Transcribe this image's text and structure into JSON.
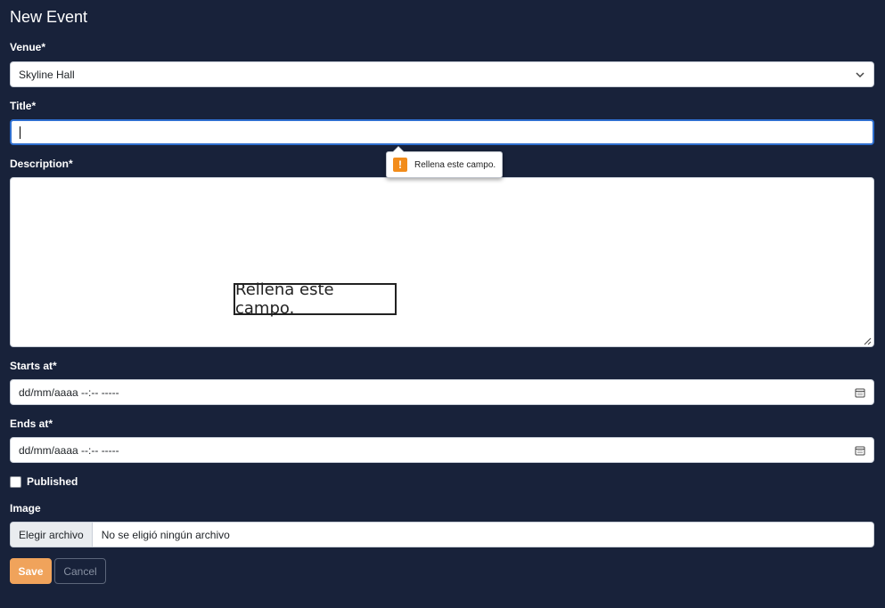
{
  "page": {
    "title": "New Event"
  },
  "form": {
    "venue": {
      "label": "Venue*",
      "selected": "Skyline Hall"
    },
    "title": {
      "label": "Title*",
      "value": ""
    },
    "description": {
      "label": "Description*",
      "value": ""
    },
    "starts_at": {
      "label": "Starts at*",
      "value": "dd/mm/aaaa --:-- -----"
    },
    "ends_at": {
      "label": "Ends at*",
      "value": "dd/mm/aaaa --:-- -----"
    },
    "published": {
      "label": "Published",
      "checked": false
    },
    "image": {
      "label": "Image",
      "button_label": "Elegir archivo",
      "status": "No se eligió ningún archivo"
    },
    "save_label": "Save",
    "cancel_label": "Cancel"
  },
  "validation": {
    "tooltip_text": "Rellena este campo.",
    "accessibility_text": "Rellena este campo.",
    "icon": "warning-icon"
  },
  "colors": {
    "background": "#18223a",
    "save_button": "#f0a35b",
    "focus_border": "#2f6fcf",
    "warning": "#f28c1b"
  },
  "icons": {
    "select_chevron": "chevron-down-icon",
    "calendar": "calendar-icon",
    "textarea_resize": "resize-handle-icon"
  }
}
